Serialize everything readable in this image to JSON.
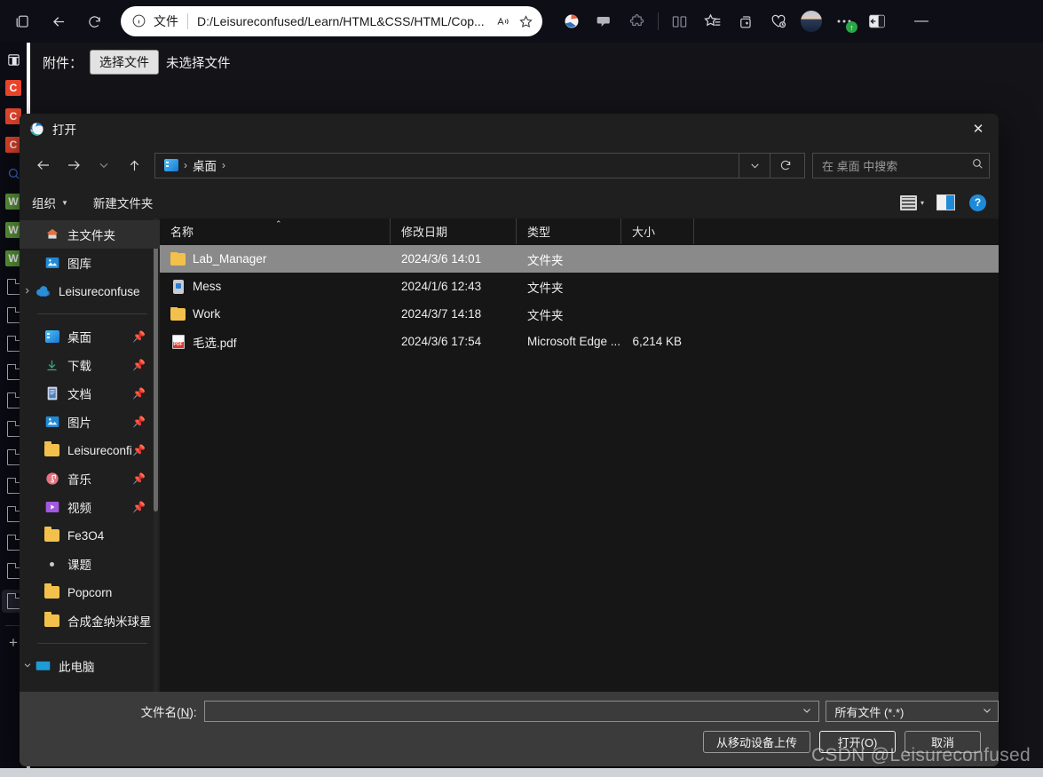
{
  "browser": {
    "tab_icon": "tab-collection-icon",
    "back_icon": "back-arrow-icon",
    "reload_icon": "reload-icon",
    "address": {
      "info_icon": "info-circle-icon",
      "scheme_label": "文件",
      "url": "D:/Leisureconfused/Learn/HTML&CSS/HTML/Cop...",
      "read_aloud_icon": "read-aloud-icon",
      "favorite_icon": "star-outline-icon"
    },
    "right_icons": [
      "browser-essentials-icon",
      "copilot-icon",
      "extensions-puzzle-icon",
      "split-screen-icon",
      "favorites-star-list-icon",
      "collections-add-icon",
      "performance-heart-icon",
      "profile-avatar",
      "settings-more-icon",
      "sidebar-toggle-icon"
    ],
    "profile_badge": "↑",
    "minimize_label": "—"
  },
  "rail": {
    "items": [
      {
        "name": "app-window-icon",
        "kind": "outline",
        "label": ""
      },
      {
        "name": "app-c-orange-1",
        "kind": "square",
        "label": "C",
        "color": "#e8452c"
      },
      {
        "name": "app-c-orange-2",
        "kind": "square",
        "label": "C",
        "color": "#e8452c"
      },
      {
        "name": "app-c-orange-3",
        "kind": "square",
        "label": "C",
        "color": "#e8452c"
      },
      {
        "name": "search-icon",
        "kind": "search",
        "label": ""
      },
      {
        "name": "app-green-1",
        "kind": "square",
        "label": "W",
        "color": "#5b9b3a"
      },
      {
        "name": "app-green-2",
        "kind": "square",
        "label": "W",
        "color": "#5b9b3a"
      },
      {
        "name": "app-green-3",
        "kind": "square",
        "label": "W",
        "color": "#5b9b3a"
      },
      {
        "name": "doc-icon-1",
        "kind": "doc",
        "label": ""
      },
      {
        "name": "doc-icon-2",
        "kind": "doc",
        "label": ""
      },
      {
        "name": "doc-icon-3",
        "kind": "doc",
        "label": ""
      },
      {
        "name": "doc-icon-4",
        "kind": "doc",
        "label": ""
      },
      {
        "name": "doc-icon-5",
        "kind": "doc",
        "label": ""
      },
      {
        "name": "doc-icon-6",
        "kind": "doc",
        "label": ""
      },
      {
        "name": "doc-icon-7",
        "kind": "doc",
        "label": ""
      },
      {
        "name": "doc-icon-8",
        "kind": "doc",
        "label": ""
      },
      {
        "name": "doc-icon-9",
        "kind": "doc",
        "label": ""
      },
      {
        "name": "doc-icon-10",
        "kind": "doc",
        "label": ""
      },
      {
        "name": "doc-icon-11",
        "kind": "doc",
        "label": ""
      },
      {
        "name": "doc-icon-12",
        "kind": "doc",
        "label": "",
        "active": true
      }
    ],
    "add_label": "+"
  },
  "page": {
    "attachment_label": "附件：",
    "choose_file_button": "选择文件",
    "no_file_text": "未选择文件"
  },
  "dialog": {
    "title": "打开",
    "logo": "edge-logo-icon",
    "close_label": "✕",
    "nav": {
      "back_icon": "back-arrow-icon",
      "forward_icon": "forward-arrow-icon",
      "recent_icon": "recent-locations-chevron-icon",
      "up_icon": "up-arrow-icon",
      "breadcrumb": [
        "桌面"
      ],
      "breadcrumb_sep": "›",
      "dropdown_icon": "chevron-down-icon",
      "refresh_icon": "refresh-icon",
      "search_placeholder": "在 桌面 中搜索",
      "search_icon": "search-icon"
    },
    "toolbar": {
      "organize_label": "组织",
      "new_folder_label": "新建文件夹",
      "view_icon": "list-view-icon",
      "view_caret": "▾",
      "preview_pane_icon": "preview-pane-icon",
      "help_label": "?"
    },
    "sidebar": {
      "groups": [
        {
          "items": [
            {
              "label": "主文件夹",
              "icon": "home-icon",
              "selected": true,
              "expandable": false,
              "pinned": false
            },
            {
              "label": "图库",
              "icon": "gallery-icon",
              "selected": false,
              "expandable": false,
              "pinned": false
            },
            {
              "label": "Leisureconfuse",
              "icon": "onedrive-cloud-icon",
              "selected": false,
              "expandable": true,
              "pinned": false
            }
          ]
        },
        {
          "items": [
            {
              "label": "桌面",
              "icon": "desktop-icon",
              "selected": false,
              "expandable": false,
              "pinned": true
            },
            {
              "label": "下载",
              "icon": "downloads-icon",
              "selected": false,
              "expandable": false,
              "pinned": true
            },
            {
              "label": "文档",
              "icon": "documents-icon",
              "selected": false,
              "expandable": false,
              "pinned": true
            },
            {
              "label": "图片",
              "icon": "pictures-icon",
              "selected": false,
              "expandable": false,
              "pinned": true
            },
            {
              "label": "Leisureconfi",
              "icon": "folder-icon",
              "selected": false,
              "expandable": false,
              "pinned": true
            },
            {
              "label": "音乐",
              "icon": "music-icon",
              "selected": false,
              "expandable": false,
              "pinned": true
            },
            {
              "label": "视频",
              "icon": "videos-icon",
              "selected": false,
              "expandable": false,
              "pinned": true
            },
            {
              "label": "Fe3O4",
              "icon": "folder-icon",
              "selected": false,
              "expandable": false,
              "pinned": false
            },
            {
              "label": "课题",
              "icon": "dot-icon",
              "selected": false,
              "expandable": false,
              "pinned": false
            },
            {
              "label": "Popcorn",
              "icon": "folder-icon",
              "selected": false,
              "expandable": false,
              "pinned": false
            },
            {
              "label": "合成金纳米球星",
              "icon": "folder-icon",
              "selected": false,
              "expandable": false,
              "pinned": false
            }
          ]
        },
        {
          "items": [
            {
              "label": "此电脑",
              "icon": "this-pc-icon",
              "selected": false,
              "expandable": true,
              "expanded": true,
              "pinned": false
            }
          ]
        }
      ]
    },
    "filelist": {
      "columns": [
        {
          "label": "名称",
          "key": "name",
          "sorted": true,
          "sort_caret": "⌃"
        },
        {
          "label": "修改日期",
          "key": "date"
        },
        {
          "label": "类型",
          "key": "type"
        },
        {
          "label": "大小",
          "key": "size"
        }
      ],
      "rows": [
        {
          "name": "Lab_Manager",
          "date": "2024/3/6 14:01",
          "type": "文件夹",
          "size": "",
          "icon": "folder-icon",
          "selected": true
        },
        {
          "name": "Mess",
          "date": "2024/1/6 12:43",
          "type": "文件夹",
          "size": "",
          "icon": "special-folder-icon",
          "selected": false
        },
        {
          "name": "Work",
          "date": "2024/3/7 14:18",
          "type": "文件夹",
          "size": "",
          "icon": "folder-icon",
          "selected": false
        },
        {
          "name": "毛选.pdf",
          "date": "2024/3/6 17:54",
          "type": "Microsoft Edge ...",
          "size": "6,214 KB",
          "icon": "pdf-icon",
          "selected": false
        }
      ]
    },
    "bottom": {
      "filename_label_prefix": "文件名(",
      "filename_label_key": "N",
      "filename_label_suffix": "):",
      "filename_value": "",
      "filename_caret": "⌄",
      "filter_value": "所有文件 (*.*)",
      "filter_caret": "⌄",
      "buttons": [
        {
          "label": "从移动设备上传",
          "name": "upload-from-mobile-button",
          "default": false
        },
        {
          "label": "打开(O)",
          "name": "open-button",
          "default": true,
          "accesskey": "O"
        },
        {
          "label": "取消",
          "name": "cancel-button",
          "default": false
        }
      ]
    }
  },
  "watermark": "CSDN @Leisureconfused"
}
